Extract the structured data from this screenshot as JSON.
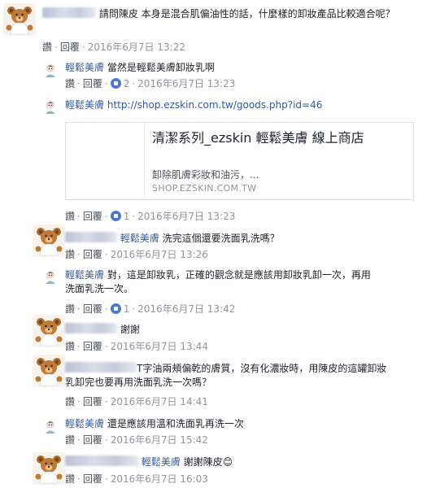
{
  "actions": {
    "like": "讚",
    "reply": "回覆",
    "sep": "·"
  },
  "comments": [
    {
      "author": "",
      "mention": "",
      "text": "請問陳皮 本身是混合肌偏油性的話，什麼樣的卸妝產品比較適合呢？",
      "likes": "",
      "time": "2016年6月7日 13:22"
    },
    {
      "author": "輕鬆美膚",
      "mention": "",
      "text": "當然是輕鬆美膚卸妝乳啊",
      "likes": "2",
      "time": "2016年6月7日 13:23"
    },
    {
      "author": "輕鬆美膚",
      "mention": "",
      "text": "http://shop.ezskin.com.tw/goods.php?id=46",
      "likes": "1",
      "time": "2016年6月7日 13:23"
    },
    {
      "author": "",
      "mention": "輕鬆美膚",
      "text": "洗完這個還要洗面乳洗嗎？",
      "likes": "",
      "time": "2016年6月7日 13:26"
    },
    {
      "author": "輕鬆美膚",
      "mention": "",
      "text": "對，這是卸妝乳，正確的觀念就是應該用卸妝乳卸一次，再用洗面乳洗一次。",
      "likes": "1",
      "time": "2016年6月7日 13:42"
    },
    {
      "author": "",
      "mention": "",
      "text": "謝謝",
      "likes": "",
      "time": "2016年6月7日 13:44"
    },
    {
      "author": "",
      "mention": "",
      "text": "T字油兩頰偏乾的膚質，沒有化濃妝時，用陳皮的這罐卸妝乳卸完也要再用洗面乳洗一次嗎？",
      "likes": "",
      "time": "2016年6月7日 14:41"
    },
    {
      "author": "輕鬆美膚",
      "mention": "",
      "text": "還是應該用溫和洗面乳再洗一次",
      "likes": "",
      "time": "2016年6月7日 15:42"
    },
    {
      "author": "",
      "mention": "輕鬆美膚",
      "text": "謝謝陳皮",
      "emoji": "😊",
      "likes": "",
      "time": "2016年6月7日 16:03"
    }
  ],
  "link_card": {
    "title": "清潔系列_ezskin 輕鬆美膚 線上商店",
    "description": "卸除肌膚彩妝和油污，...",
    "domain": "SHOP.EZSKIN.COM.TW"
  },
  "colors": {
    "link": "#365899",
    "meta": "#90949c",
    "text": "#1d2129",
    "like": "#4a78d8"
  }
}
